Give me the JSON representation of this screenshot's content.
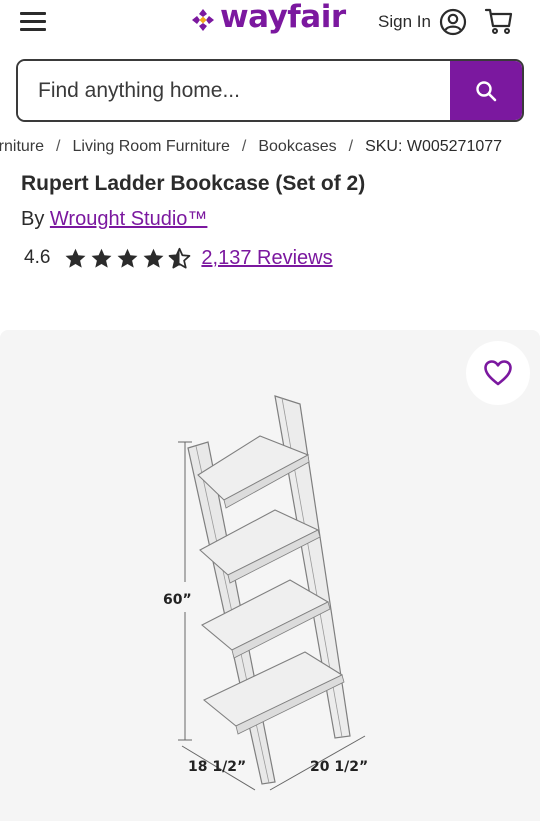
{
  "header": {
    "logo_text": "wayfair",
    "sign_in_label": "Sign In",
    "brand_color": "#7b189f"
  },
  "search": {
    "placeholder": "Find anything home..."
  },
  "breadcrumb": {
    "items": [
      "Furniture",
      "Living Room Furniture",
      "Bookcases"
    ],
    "separator": "/",
    "sku": "SKU: W005271077"
  },
  "product": {
    "title": "Rupert Ladder Bookcase (Set of 2)",
    "by_label": "By",
    "brand": "Wrought Studio™",
    "rating": "4.6",
    "stars_filled": 4.5,
    "reviews_label": "2,137 Reviews"
  },
  "image": {
    "dimensions": {
      "height": "60”",
      "depth": "18 1/2”",
      "width": "20 1/2”"
    }
  },
  "icons": {
    "menu": "hamburger-icon",
    "account": "user-circle-icon",
    "cart": "cart-icon",
    "search": "search-icon",
    "favorite": "heart-icon"
  }
}
